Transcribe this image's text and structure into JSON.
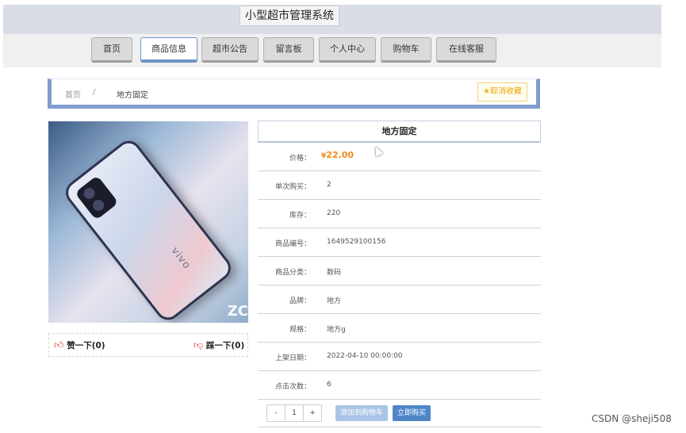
{
  "header": {
    "site_title": "小型超市管理系统"
  },
  "nav": {
    "items": [
      {
        "label": "首页"
      },
      {
        "label": "商品信息"
      },
      {
        "label": "超市公告"
      },
      {
        "label": "留言板"
      },
      {
        "label": "个人中心"
      },
      {
        "label": "购物车"
      },
      {
        "label": "在线客服"
      }
    ],
    "active": "商品信息"
  },
  "breadcrumb": {
    "home": "首页",
    "separator": "/",
    "current": "地方固定",
    "unfavorite_label": "取消收藏",
    "unfavorite_icon": "star-icon"
  },
  "product": {
    "image_brand_text": "vivo",
    "image_corner_text": "ZC",
    "title": "地方固定",
    "price_label": "价格：",
    "price_currency": "¥",
    "price_value": "22.00",
    "fields": [
      {
        "label": "单次购买：",
        "value": "2"
      },
      {
        "label": "库存：",
        "value": "220"
      },
      {
        "label": "商品编号：",
        "value": "1649529100156"
      },
      {
        "label": "商品分类：",
        "value": "数码"
      },
      {
        "label": "品牌：",
        "value": "地方"
      },
      {
        "label": "规格：",
        "value": "地方g"
      },
      {
        "label": "上架日期：",
        "value": "2022-04-10 00:00:00"
      },
      {
        "label": "点击次数：",
        "value": "6"
      }
    ],
    "like_label": "赞一下(0)",
    "dislike_label": "踩一下(0)"
  },
  "actions": {
    "minus": "-",
    "quantity": "1",
    "plus": "+",
    "add_to_cart": "添加到购物车",
    "buy_now": "立即购买"
  },
  "watermark": "CSDN @sheji508",
  "colors": {
    "accent": "#7f9ccd",
    "price": "#f08c1b",
    "buy_button": "#4e86c8"
  }
}
